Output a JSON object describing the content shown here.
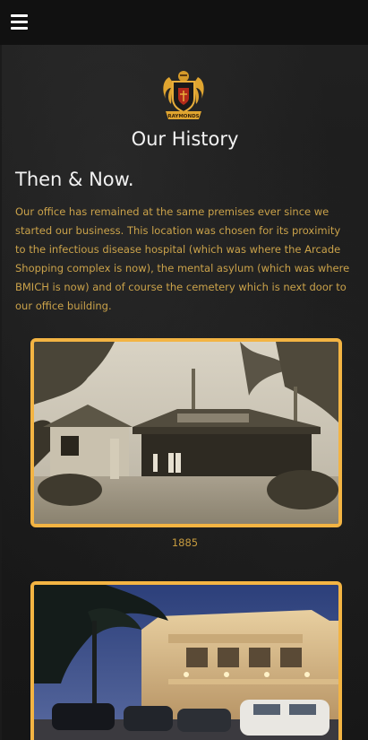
{
  "header": {
    "menu_icon": "hamburger-menu-icon"
  },
  "crest": {
    "icon": "family-crest-logo",
    "banner_text": "RAYMONDS"
  },
  "page": {
    "title": "Our History"
  },
  "section": {
    "heading": "Then & Now.",
    "body": "Our office has remained at the same premises ever since we started our business. This location was chosen for its proximity to the infectious disease hospital (which was where the Arcade Shopping complex is now), the mental asylum (which was where BMICH is now) and of course the cemetery which is next door to our office building."
  },
  "gallery": [
    {
      "caption": "1885",
      "image": "historic-office-building-photo"
    },
    {
      "caption": "",
      "image": "modern-office-building-night-photo"
    }
  ],
  "colors": {
    "accent_gold": "#f3b443",
    "body_text": "#caa24a",
    "heading_text": "#f2f2f2",
    "topbar": "#111111"
  }
}
